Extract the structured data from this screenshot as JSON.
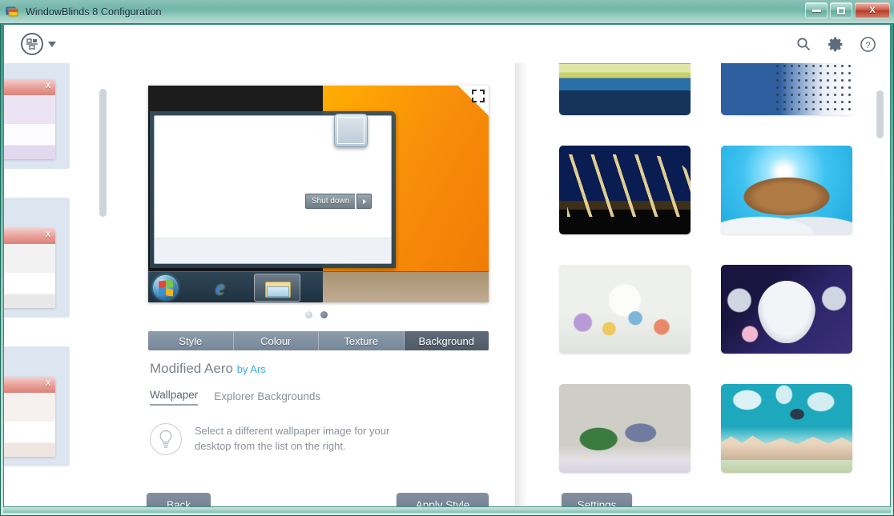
{
  "window": {
    "title": "WindowBlinds 8 Configuration",
    "app_icon": "windowblinds-icon",
    "controls": {
      "minimize": "minimize-icon",
      "maximize": "maximize-icon",
      "close": "X"
    },
    "frame_color": "#2e8b7a",
    "title_color": "#112233"
  },
  "toolbar": {
    "menu_icon": "layout-menu-icon",
    "menu_caret": "chevron-down-icon",
    "search_icon": "search-icon",
    "settings_icon": "gear-icon",
    "help_icon": "help-icon"
  },
  "sidebar": {
    "scrollbar": "vertical-scrollbar",
    "thumbnails": [
      {
        "name": "style-thumbnail-1",
        "tint": "#ece4f4",
        "close_label": "X"
      },
      {
        "name": "style-thumbnail-2",
        "tint": "#f2f2f2",
        "close_label": "X"
      },
      {
        "name": "style-thumbnail-3",
        "tint": "#f6f0ee",
        "close_label": "X"
      }
    ]
  },
  "preview": {
    "expand_icon": "fullscreen-icon",
    "shutdown_label": "Shut down",
    "shutdown_arrow": "chevron-right-icon",
    "start_orb": "windows-start-orb-icon",
    "ie_glyph": "e",
    "ie_icon": "internet-explorer-icon",
    "explorer_icon": "file-explorer-icon",
    "thumbnail_icon": "kitten-thumbnail",
    "accent_wallpaper": "#f98e0a",
    "pager": {
      "count": 2,
      "active_index": 1
    }
  },
  "tabs": [
    {
      "label": "Style",
      "active": false
    },
    {
      "label": "Colour",
      "active": false
    },
    {
      "label": "Texture",
      "active": false
    },
    {
      "label": "Background",
      "active": true
    }
  ],
  "style": {
    "name": "Modified Aero",
    "author": "by Ars"
  },
  "subtabs": [
    {
      "label": "Wallpaper",
      "active": true
    },
    {
      "label": "Explorer Backgrounds",
      "active": false
    }
  ],
  "hint": {
    "icon": "lightbulb-icon",
    "line1": "Select a different wallpaper image for your",
    "line2": "desktop from the list on the right."
  },
  "buttons": {
    "back": "Back",
    "apply": "Apply Style",
    "settings": "Settings"
  },
  "gallery": {
    "scrollbar": "vertical-scrollbar",
    "wallpapers": [
      {
        "name": "wallpaper-speed-lines",
        "art": "art-speedline",
        "partial": true
      },
      {
        "name": "wallpaper-dot-tunnel",
        "art": "art-dots",
        "partial": true
      },
      {
        "name": "wallpaper-night-bridge",
        "art": "art-bridge",
        "partial": false
      },
      {
        "name": "wallpaper-flying-turtle",
        "art": "art-turtle",
        "partial": false
      },
      {
        "name": "wallpaper-whimsy-town",
        "art": "art-whimsy",
        "partial": false
      },
      {
        "name": "wallpaper-ghost-cat",
        "art": "art-ghost",
        "partial": false
      },
      {
        "name": "wallpaper-green-insect",
        "art": "art-insect",
        "partial": false
      },
      {
        "name": "wallpaper-sky-flyer",
        "art": "art-flyer",
        "partial": false
      }
    ]
  }
}
